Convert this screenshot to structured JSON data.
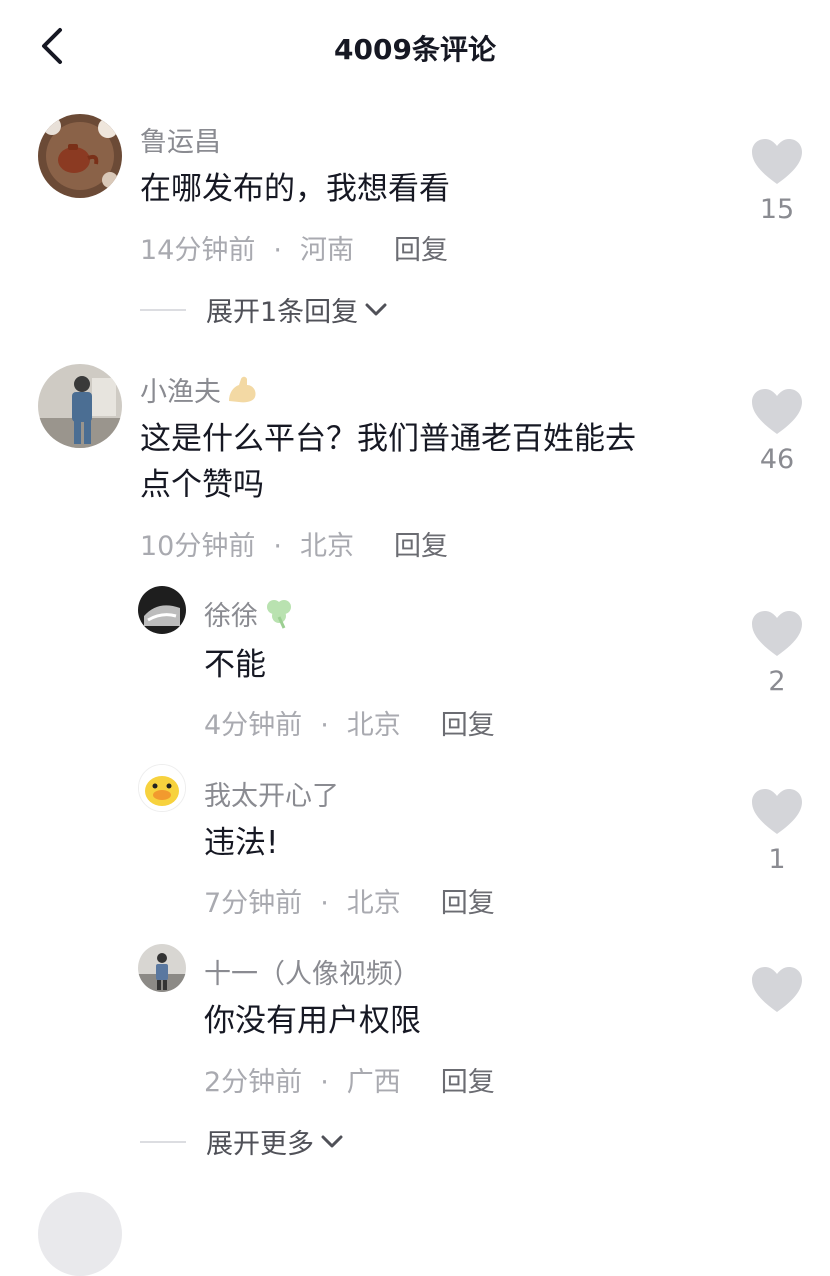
{
  "header": {
    "title": "4009条评论",
    "back_icon": "chevron-left-icon"
  },
  "comments": [
    {
      "username": "鲁运昌",
      "content": "在哪发布的，我想看看",
      "time": "14分钟前",
      "location": "河南",
      "reply_label": "回复",
      "likes": "15",
      "expand_label": "展开1条回复"
    },
    {
      "username": "小渔夫",
      "username_emoji": "flexed-biceps-icon",
      "content_line1": "这是什么平台？我们普通老百姓能去",
      "content_line2": "点个赞吗",
      "time": "10分钟前",
      "location": "北京",
      "reply_label": "回复",
      "likes": "46",
      "replies": [
        {
          "username": "徐徐",
          "username_emoji": "shamrock-icon",
          "content": "不能",
          "time": "4分钟前",
          "location": "北京",
          "reply_label": "回复",
          "likes": "2"
        },
        {
          "username": "我太开心了",
          "content": "违法!",
          "time": "7分钟前",
          "location": "北京",
          "reply_label": "回复",
          "likes": "1"
        },
        {
          "username": "十一（人像视频）",
          "content": "你没有用户权限",
          "time": "2分钟前",
          "location": "广西",
          "reply_label": "回复",
          "likes": ""
        }
      ],
      "expand_label": "展开更多"
    }
  ],
  "separator": "·",
  "colors": {
    "like_icon": "#d4d5d9",
    "meta_text": "#a9aab0",
    "name_text": "#8a8b91"
  }
}
